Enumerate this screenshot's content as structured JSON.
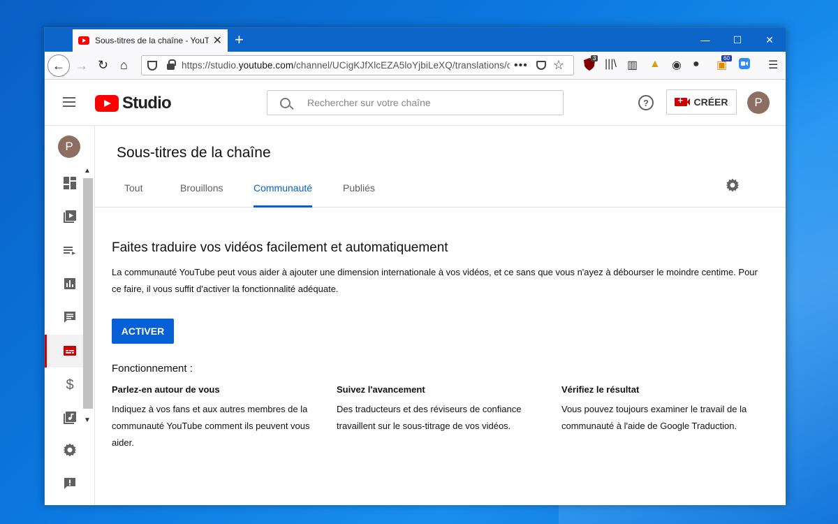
{
  "browser": {
    "tab_title": "Sous-titres de la chaîne - YouTube",
    "url_prefix": "https://studio.",
    "url_domain": "youtube.com",
    "url_path": "/channel/UCigKJfXlcEZA5loYjbiLeXQ/translations/c",
    "ext_badge_1": "3",
    "ext_badge_2": "60"
  },
  "header": {
    "logo_text": "Studio",
    "search_placeholder": "Rechercher sur votre chaîne",
    "create_label": "CRÉER",
    "avatar_letter": "P"
  },
  "sidebar": {
    "avatar_letter": "P",
    "items": [
      {
        "icon": "dashboard-icon"
      },
      {
        "icon": "videos-icon"
      },
      {
        "icon": "playlists-icon"
      },
      {
        "icon": "analytics-icon"
      },
      {
        "icon": "comments-icon"
      },
      {
        "icon": "subtitles-icon",
        "active": true
      },
      {
        "icon": "monetization-icon"
      },
      {
        "icon": "audio-library-icon"
      },
      {
        "icon": "settings-icon"
      },
      {
        "icon": "feedback-icon"
      }
    ]
  },
  "main": {
    "page_title": "Sous-titres de la chaîne",
    "tabs": [
      {
        "label": "Tout"
      },
      {
        "label": "Brouillons"
      },
      {
        "label": "Communauté",
        "active": true
      },
      {
        "label": "Publiés"
      }
    ],
    "section_title": "Faites traduire vos vidéos facilement et automatiquement",
    "section_desc": "La communauté YouTube peut vous aider à ajouter une dimension internationale à vos vidéos, et ce sans que vous n'ayez à débourser le moindre centime. Pour ce faire, il vous suffit d'activer la fonctionnalité adéquate.",
    "activate_label": "ACTIVER",
    "how_title": "Fonctionnement :",
    "columns": [
      {
        "title": "Parlez-en autour de vous",
        "text": "Indiquez à vos fans et aux autres membres de la communauté YouTube comment ils peuvent vous aider."
      },
      {
        "title": "Suivez l'avancement",
        "text": "Des traducteurs et des réviseurs de confiance travaillent sur le sous-titrage de vos vidéos."
      },
      {
        "title": "Vérifiez le résultat",
        "text": "Vous pouvez toujours examiner le travail de la communauté à l'aide de Google Traduction."
      }
    ]
  },
  "colors": {
    "accent_blue": "#065fd4",
    "youtube_red": "#ff0000",
    "titlebar_blue": "#0c64c8"
  }
}
